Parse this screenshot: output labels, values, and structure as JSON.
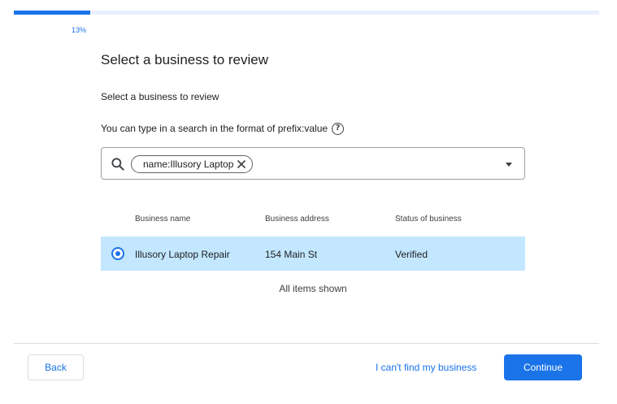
{
  "progress": {
    "percent_label": "13%",
    "fraction": 0.13
  },
  "page": {
    "title": "Select a business to review",
    "subtitle": "Select a business to review",
    "hint": "You can type in a search in the format of prefix:value",
    "help_icon_glyph": "?"
  },
  "search": {
    "chip_label": "name:Illusory Laptop"
  },
  "table": {
    "headers": [
      "Business name",
      "Business address",
      "Status of business"
    ],
    "rows": [
      {
        "name": "Illusory Laptop Repair",
        "address": "154 Main St",
        "status": "Verified",
        "selected": true
      }
    ],
    "footer": "All items shown"
  },
  "footer": {
    "back_label": "Back",
    "cant_find_label": "I can't find my business",
    "continue_label": "Continue"
  },
  "colors": {
    "accent": "#1a73e8",
    "selected_row": "#c2e7ff",
    "progress_track": "#e8f0fe"
  },
  "icons": [
    "search-icon",
    "help-icon",
    "close-icon",
    "dropdown-arrow-icon",
    "radio-selected-icon"
  ]
}
